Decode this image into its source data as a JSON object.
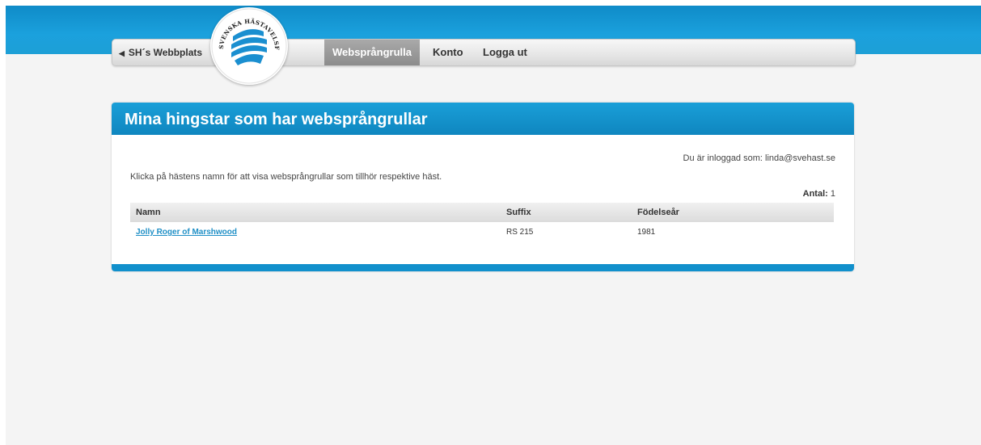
{
  "colors": {
    "brand_blue": "#1a9fd8",
    "link": "#1f8fc6",
    "active_tab": "#999999"
  },
  "nav": {
    "back_label": "SH´s Webbplats",
    "back_icon": "caret-left-icon",
    "logo_text": "SVENSKA HÄSTAVELSFÖRBUNDET",
    "items": [
      {
        "label": "Websprångrulla",
        "active": true
      },
      {
        "label": "Konto",
        "active": false
      },
      {
        "label": "Logga ut",
        "active": false
      }
    ]
  },
  "panel": {
    "title": "Mina hingstar som har websprångrullar",
    "logged_in": "Du är inloggad som: linda@svehast.se",
    "intro": "Klicka på hästens namn för att visa websprångrullar som tillhör respektive häst.",
    "count_label": "Antal:",
    "count_value": "1"
  },
  "table": {
    "headers": [
      "Namn",
      "Suffix",
      "Födelseår"
    ],
    "rows": [
      {
        "name": "Jolly Roger of Marshwood",
        "suffix": "RS 215",
        "year": "1981"
      }
    ]
  }
}
